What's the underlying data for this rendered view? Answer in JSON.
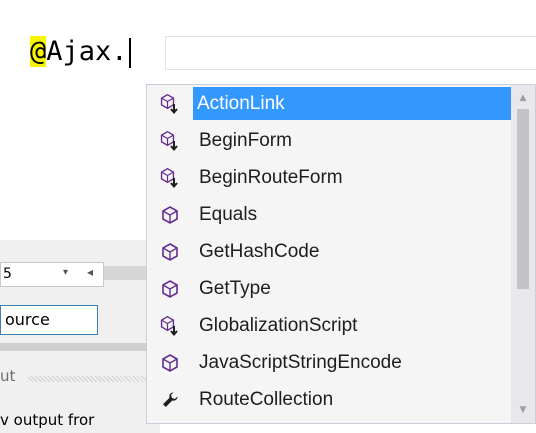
{
  "editor": {
    "prefix": "@",
    "code": "Ajax."
  },
  "background": {
    "dropdown_value": "5",
    "dropdown_arrow": "▾",
    "nav_arrow": "◂",
    "source_label": "ource",
    "output_label": "ut",
    "output_text": "v output fror"
  },
  "completion": {
    "selected_index": 0,
    "items": [
      {
        "label": "ActionLink",
        "icon": "extension-method-icon"
      },
      {
        "label": "BeginForm",
        "icon": "extension-method-icon"
      },
      {
        "label": "BeginRouteForm",
        "icon": "extension-method-icon"
      },
      {
        "label": "Equals",
        "icon": "method-icon"
      },
      {
        "label": "GetHashCode",
        "icon": "method-icon"
      },
      {
        "label": "GetType",
        "icon": "method-icon"
      },
      {
        "label": "GlobalizationScript",
        "icon": "extension-method-icon"
      },
      {
        "label": "JavaScriptStringEncode",
        "icon": "method-icon"
      },
      {
        "label": "RouteCollection",
        "icon": "property-wrench-icon"
      }
    ]
  },
  "colors": {
    "selection": "#3399ff",
    "method_icon": "#652d90",
    "highlight": "#f5f500"
  }
}
